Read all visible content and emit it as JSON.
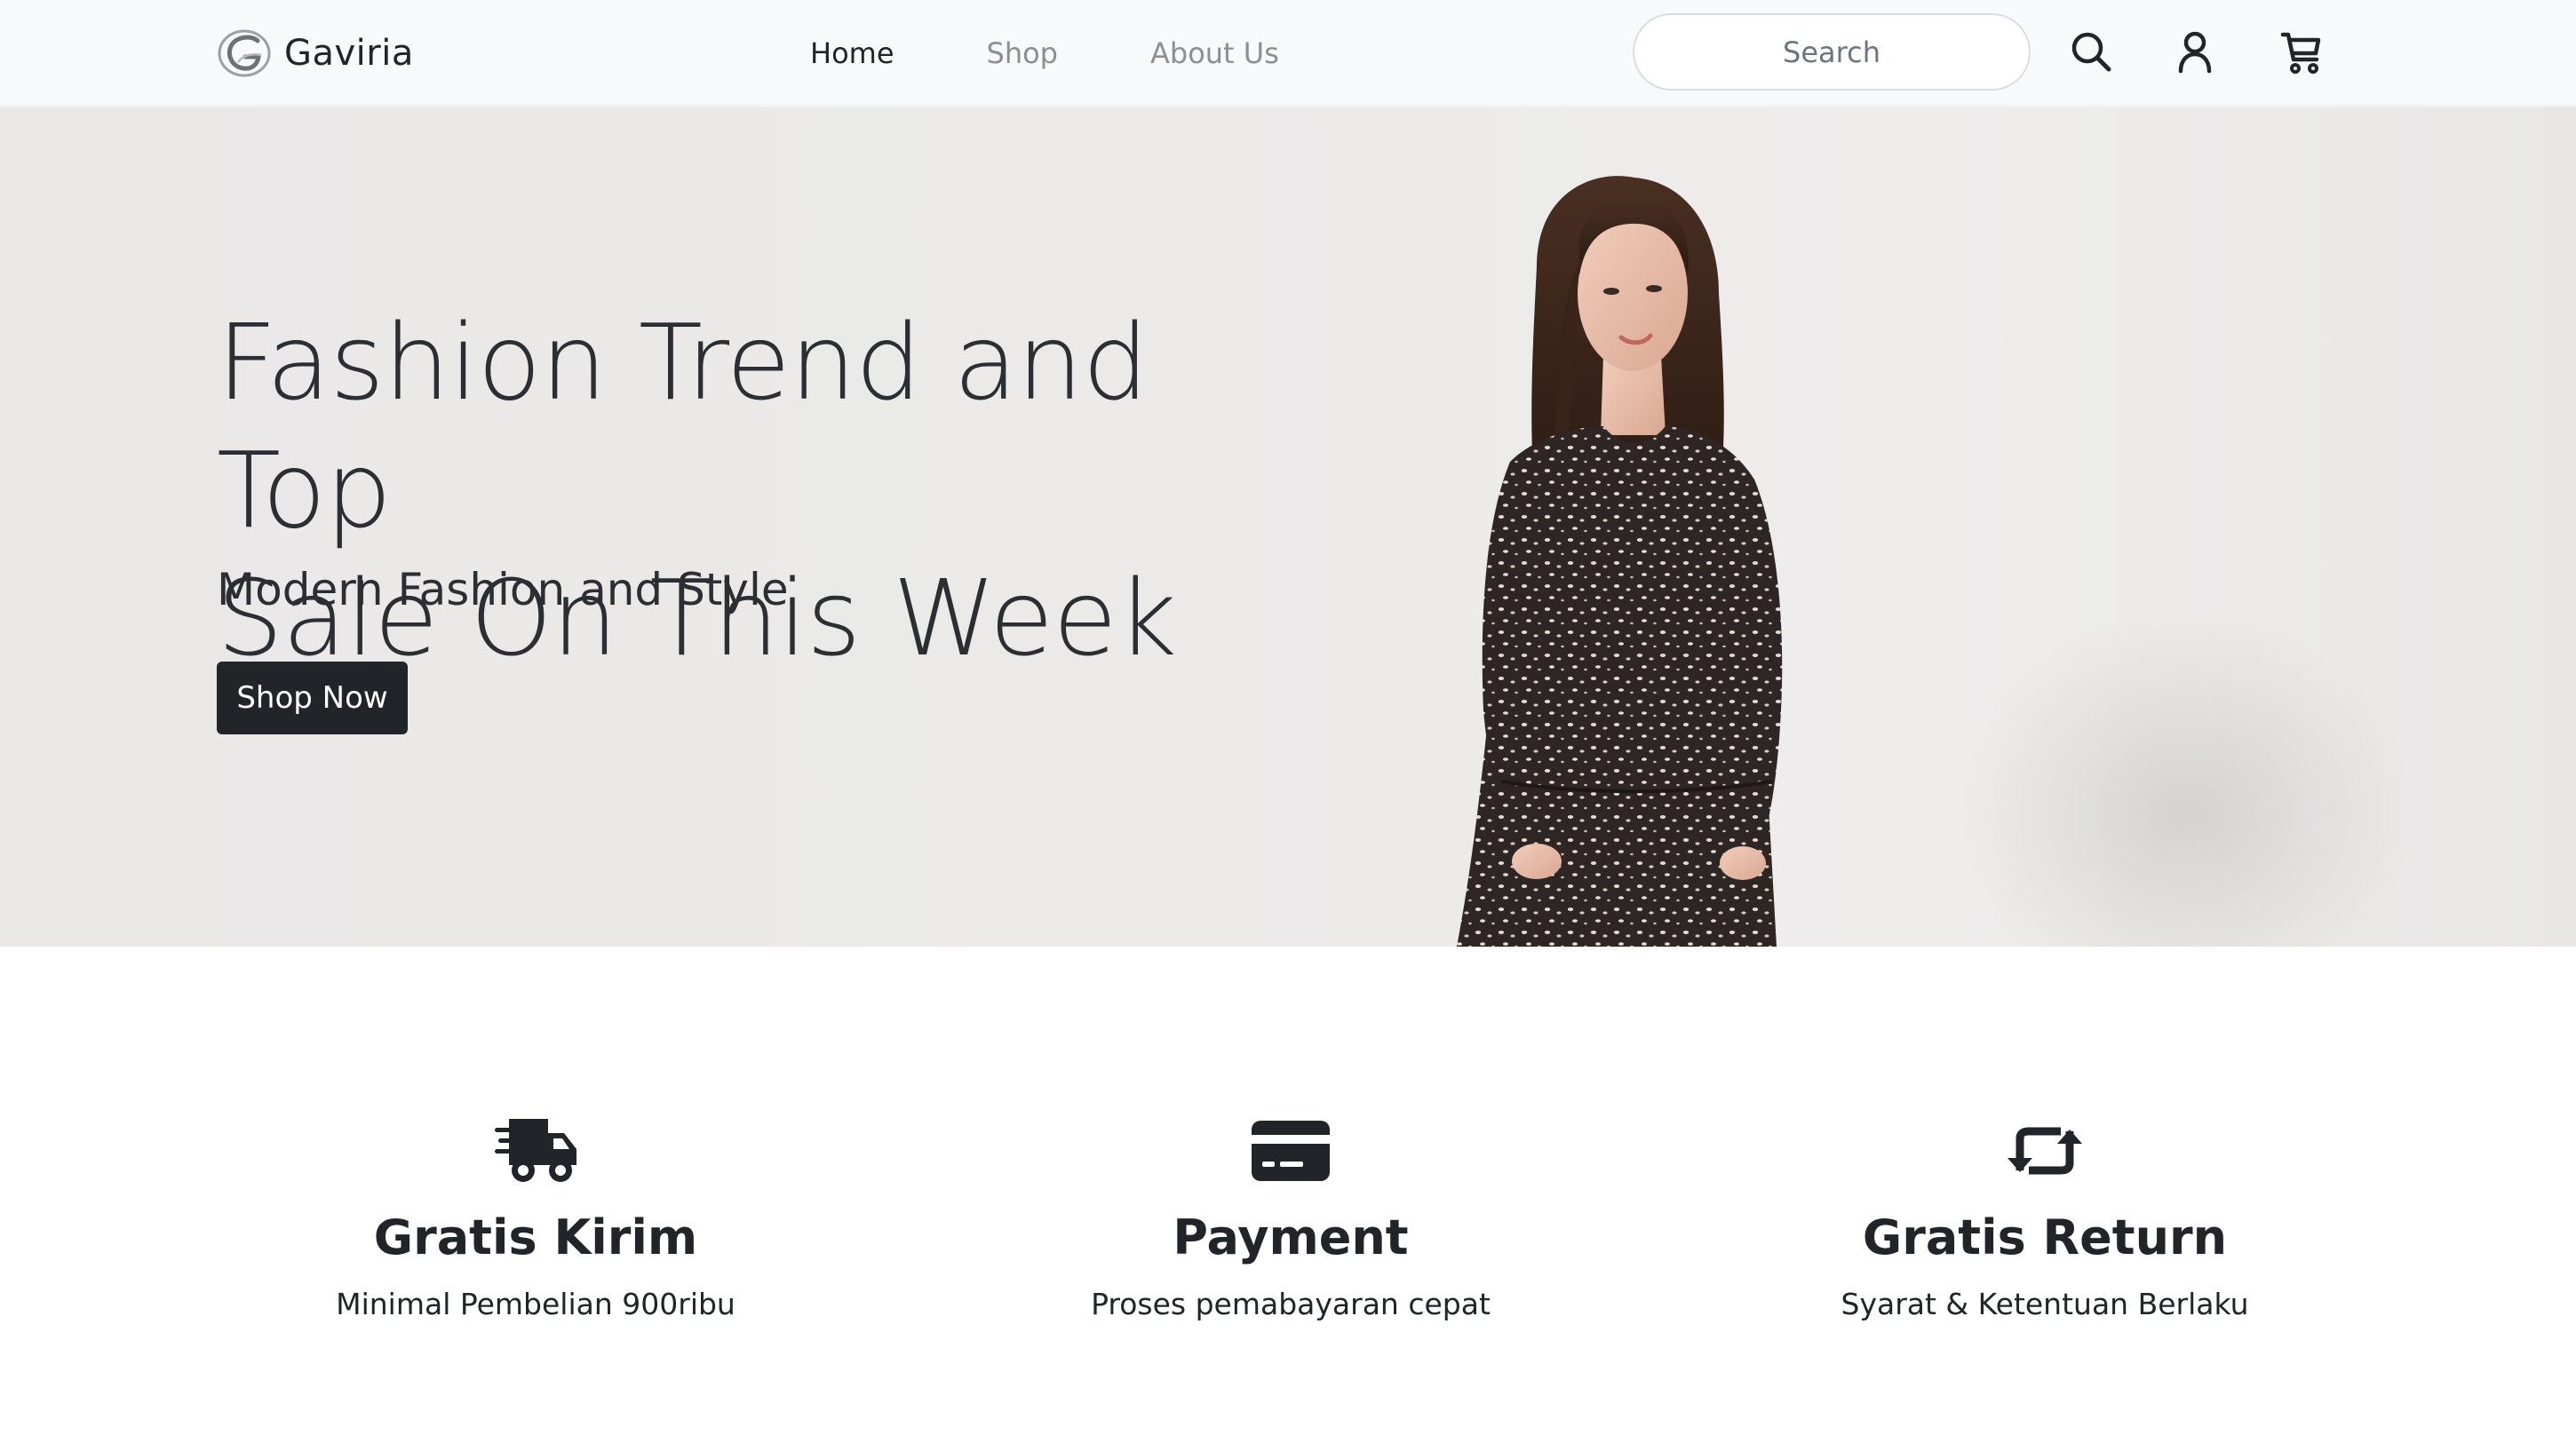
{
  "navbar": {
    "brand": "Gaviria",
    "links": [
      {
        "label": "Home",
        "active": true
      },
      {
        "label": "Shop",
        "active": false
      },
      {
        "label": "About Us",
        "active": false
      }
    ],
    "search_placeholder": "Search",
    "icons": [
      "search-icon",
      "user-icon",
      "cart-icon"
    ]
  },
  "hero": {
    "title_line1": "Fashion Trend and Top",
    "title_line2": "Sale On This Week",
    "subtitle": "Modern Fashion and Style",
    "cta_label": "Shop Now"
  },
  "features": [
    {
      "icon": "truck-fast-icon",
      "title": "Gratis Kirim",
      "desc": "Minimal Pembelian 900ribu"
    },
    {
      "icon": "credit-card-icon",
      "title": "Payment",
      "desc": "Proses pemabayaran cepat"
    },
    {
      "icon": "return-arrows-icon",
      "title": "Gratis Return",
      "desc": "Syarat & Ketentuan Berlaku"
    }
  ],
  "colors": {
    "navbar_bg": "#f8f9fa",
    "hero_bg": "#ebeae9",
    "dark": "#212529",
    "muted_link": "#8a8f94"
  }
}
